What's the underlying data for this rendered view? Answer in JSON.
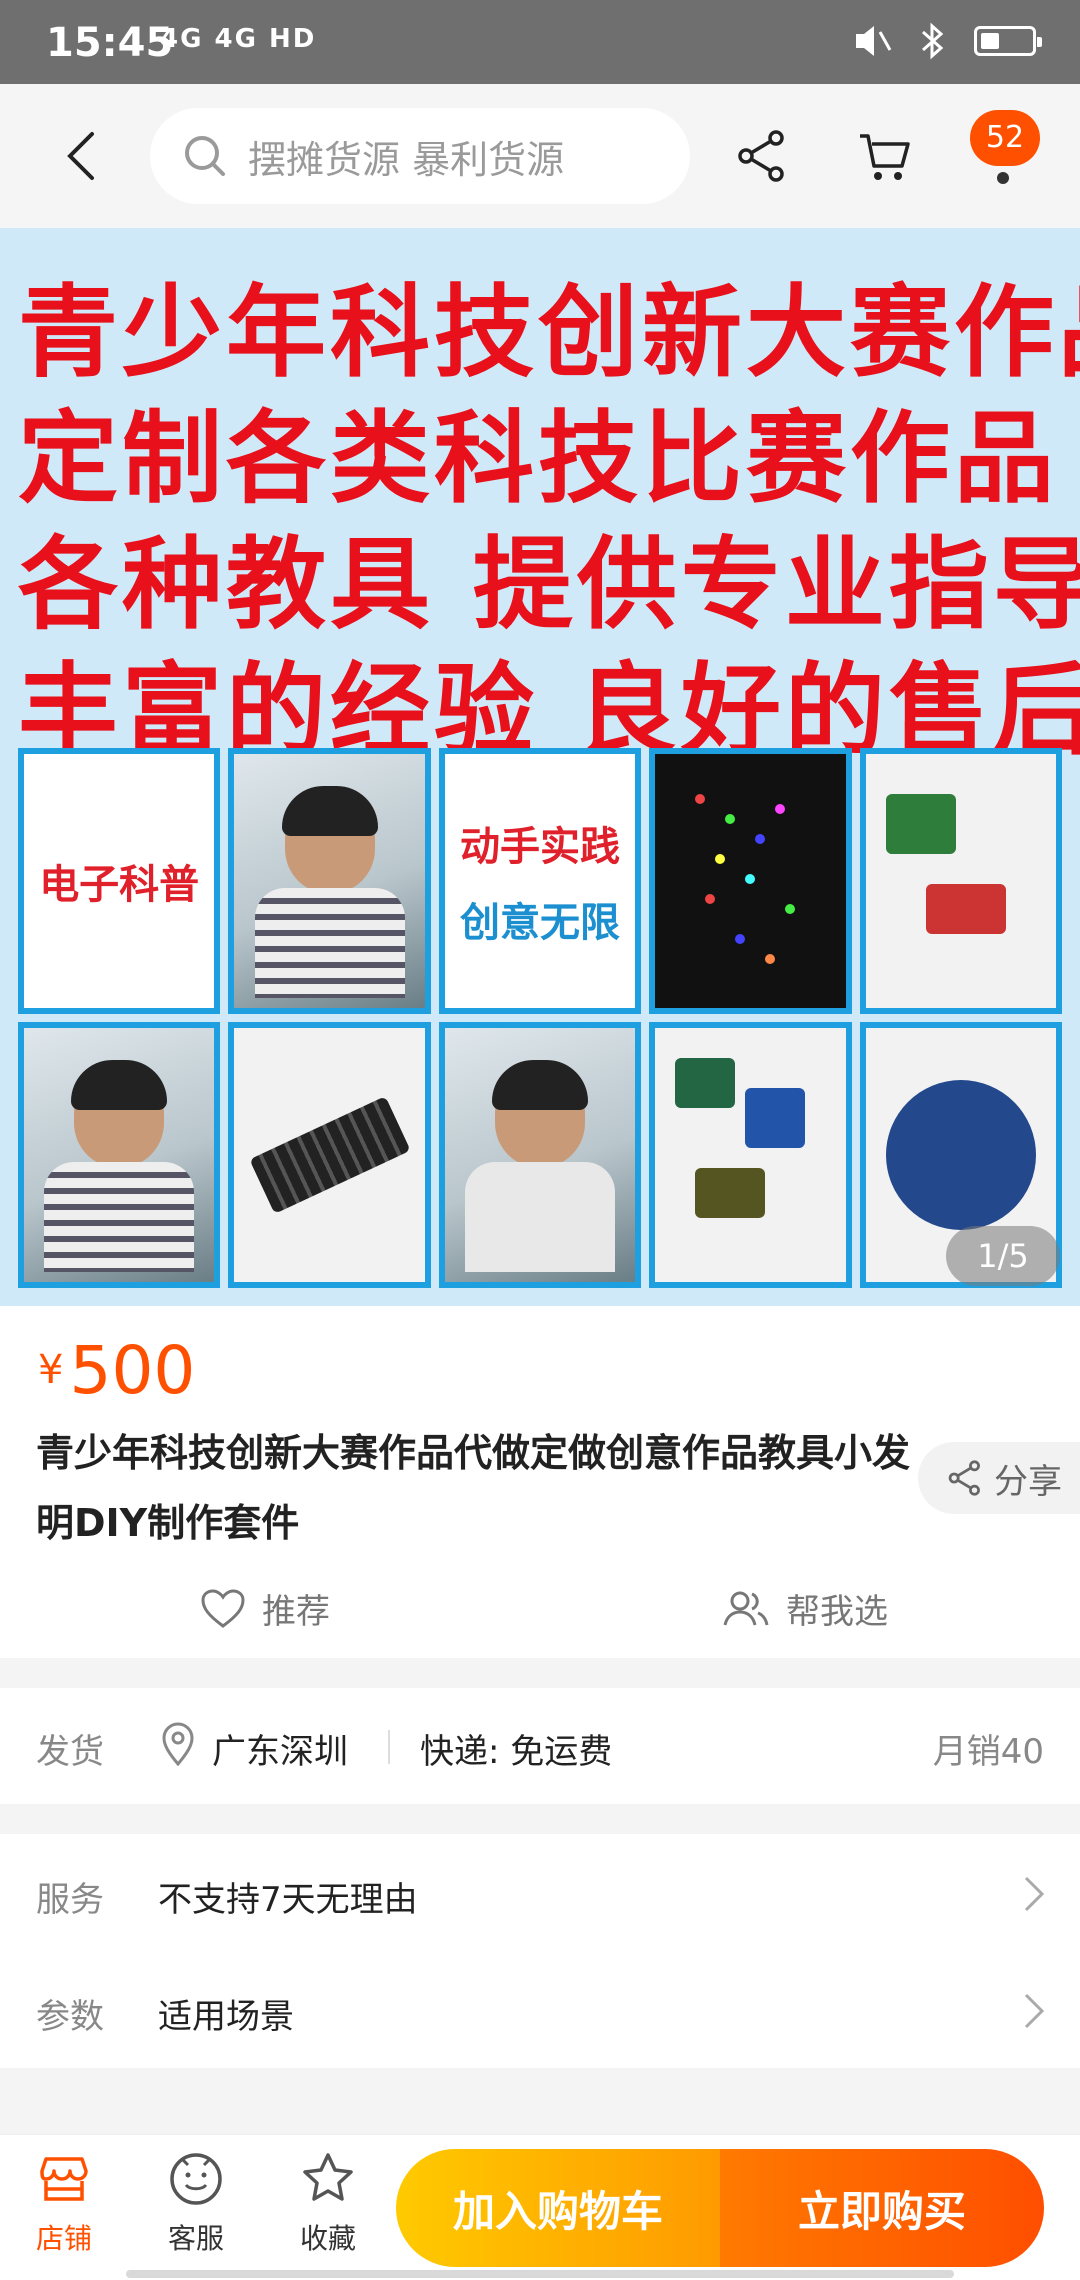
{
  "status_bar": {
    "time": "15:45",
    "network": "4G 4G HD",
    "icons": [
      "mute-icon",
      "bluetooth-icon",
      "battery-icon"
    ]
  },
  "nav": {
    "search_placeholder": "摆摊货源 暴利货源",
    "cart_count": "52",
    "icons": [
      "back-icon",
      "search-icon",
      "share-icon",
      "cart-icon"
    ]
  },
  "banner": {
    "lines": [
      "青少年科技创新大赛作品",
      "定制各类科技比赛作品",
      "各种教具  提供专业指导",
      "丰富的经验  良好的售后!!"
    ],
    "tile_texts": {
      "electronics": "电子科普",
      "practice": "动手实践",
      "creativity": "创意无限"
    },
    "pager": "1/5"
  },
  "product": {
    "currency": "¥",
    "price": "500",
    "title": "青少年科技创新大赛作品代做定做创意作品教具小发明DIY制作套件",
    "share_label": "分享",
    "recommend_label": "推荐",
    "help_choose_label": "帮我选"
  },
  "shipping": {
    "label": "发货",
    "location": "广东深圳",
    "express": "快递: 免运费",
    "monthly_sales": "月销40"
  },
  "service": {
    "rows": [
      {
        "label": "服务",
        "value": "不支持7天无理由"
      },
      {
        "label": "参数",
        "value": "适用场景"
      }
    ]
  },
  "bottom_bar": {
    "tabs": [
      {
        "label": "店铺",
        "icon": "store-icon"
      },
      {
        "label": "客服",
        "icon": "customer-service-icon"
      },
      {
        "label": "收藏",
        "icon": "star-icon"
      }
    ],
    "add_to_cart": "加入购物车",
    "buy_now": "立即购买"
  },
  "colors": {
    "accent": "#ff5000",
    "banner_text": "#e8101a",
    "cart_button": "#ffb400",
    "buy_button": "#ff5a00"
  }
}
